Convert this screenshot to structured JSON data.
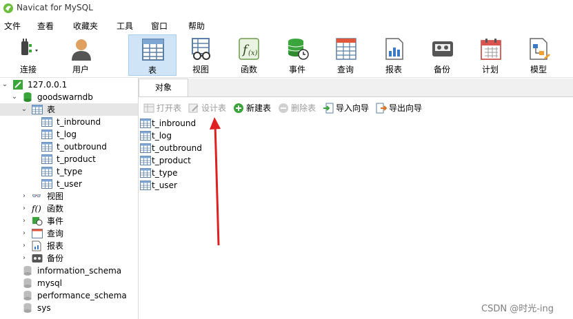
{
  "window": {
    "title": "Navicat for MySQL"
  },
  "menu": [
    "文件",
    "查看",
    "收藏夹",
    "工具",
    "窗口",
    "帮助"
  ],
  "toolbar": {
    "buttons": [
      {
        "label": "连接"
      },
      {
        "label": "用户"
      },
      {
        "label": "表"
      },
      {
        "label": "视图"
      },
      {
        "label": "函数"
      },
      {
        "label": "事件"
      },
      {
        "label": "查询"
      },
      {
        "label": "报表"
      },
      {
        "label": "备份"
      },
      {
        "label": "计划"
      },
      {
        "label": "模型"
      }
    ]
  },
  "tree": {
    "connection": "127.0.0.1",
    "database": "goodswarndb",
    "tables_node": "表",
    "tables": [
      "t_inbround",
      "t_log",
      "t_outbround",
      "t_product",
      "t_type",
      "t_user"
    ],
    "nodes": [
      "视图",
      "函数",
      "事件",
      "查询",
      "报表",
      "备份"
    ],
    "other_dbs": [
      "information_schema",
      "mysql",
      "performance_schema",
      "sys"
    ]
  },
  "tabs": {
    "objects": "对象"
  },
  "object_toolbar": {
    "open": "打开表",
    "design": "设计表",
    "new": "新建表",
    "delete": "删除表",
    "import": "导入向导",
    "export": "导出向导"
  },
  "object_list": [
    "t_inbround",
    "t_log",
    "t_outbround",
    "t_product",
    "t_type",
    "t_user"
  ],
  "watermark": "CSDN @时光-ing",
  "colors": {
    "accent": "#cfe4f7",
    "arrow": "#e02020",
    "db_green": "#3aa53a"
  }
}
